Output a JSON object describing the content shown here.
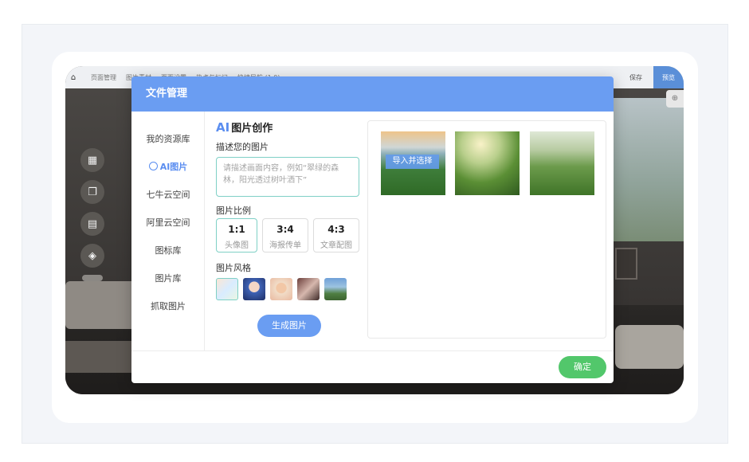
{
  "topbar": {
    "items": [
      "页面管理",
      "图片素材",
      "页面设置",
      "热点与标记",
      "快捷导航 (1.0)"
    ],
    "save_label": "保存",
    "preview_label": "预览"
  },
  "modal": {
    "title": "文件管理",
    "sidebar": {
      "items": [
        {
          "label": "我的资源库",
          "active": false
        },
        {
          "label": "AI图片",
          "active": true
        },
        {
          "label": "七牛云空间",
          "active": false
        },
        {
          "label": "阿里云空间",
          "active": false
        },
        {
          "label": "图标库",
          "active": false
        },
        {
          "label": "图片库",
          "active": false
        },
        {
          "label": "抓取图片",
          "active": false
        }
      ]
    },
    "creator": {
      "title_prefix": "AI",
      "title": "图片创作",
      "describe_label": "描述您的图片",
      "prompt_placeholder": "请描述画面内容，例如“翠绿的森林，阳光透过树叶洒下”",
      "ratio_label": "图片比例",
      "ratios": [
        {
          "value": "1:1",
          "desc": "头像图",
          "selected": true
        },
        {
          "value": "3:4",
          "desc": "海报传单",
          "selected": false
        },
        {
          "value": "4:3",
          "desc": "文章配图",
          "selected": false
        }
      ],
      "style_label": "图片风格",
      "generate_label": "生成图片"
    },
    "gallery": {
      "import_label": "导入并选择"
    },
    "confirm_label": "确定"
  },
  "colors": {
    "primary": "#6a9df2",
    "confirm": "#52c76b",
    "selected_border": "#7fd0c6"
  }
}
